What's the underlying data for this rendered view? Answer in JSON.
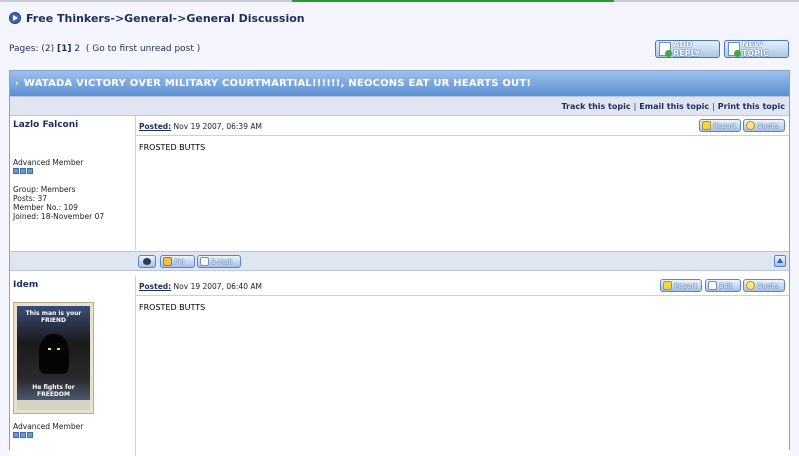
{
  "breadcrumb": "Free Thinkers->General->General Discussion",
  "pages": {
    "label": "Pages:",
    "count": "(2)",
    "current": "[1]",
    "next": "2",
    "first_unread": "( Go to first unread post )"
  },
  "buttons": {
    "add_reply": "ADD REPLY",
    "new_topic": "NEW TOPIC"
  },
  "topic": {
    "arrow": "›",
    "title": "WATADA VICTORY OVER MILITARY COURTMARTIAL!!!!!!, NEOCONS EAT UR HEARTS OUT!"
  },
  "topic_links": {
    "track": "Track this topic",
    "email": "Email this topic",
    "print": "Print this topic",
    "sep": "|"
  },
  "posts": [
    {
      "author": "Lazlo Falconi",
      "rank": "Advanced Member",
      "group": "Group: Members",
      "posts": "Posts: 37",
      "member_no": "Member No.: 109",
      "joined": "Joined: 18-November 07",
      "posted_label": "Posted:",
      "date": "Nov 19 2007, 06:39 AM",
      "body": "FROSTED BUTTS",
      "report": "Report",
      "quote": "Quote",
      "pm": "PM",
      "email": "E-Mail"
    },
    {
      "author": "Idem",
      "rank": "Advanced Member",
      "posted_label": "Posted:",
      "date": "Nov 19 2007, 06:40 AM",
      "body": "FROSTED BUTTS",
      "report": "Report",
      "edit": "Edit",
      "quote": "Quote",
      "avatar_top": "This man is your FRIEND",
      "avatar_bottom": "He fights for FREEDOM"
    }
  ]
}
